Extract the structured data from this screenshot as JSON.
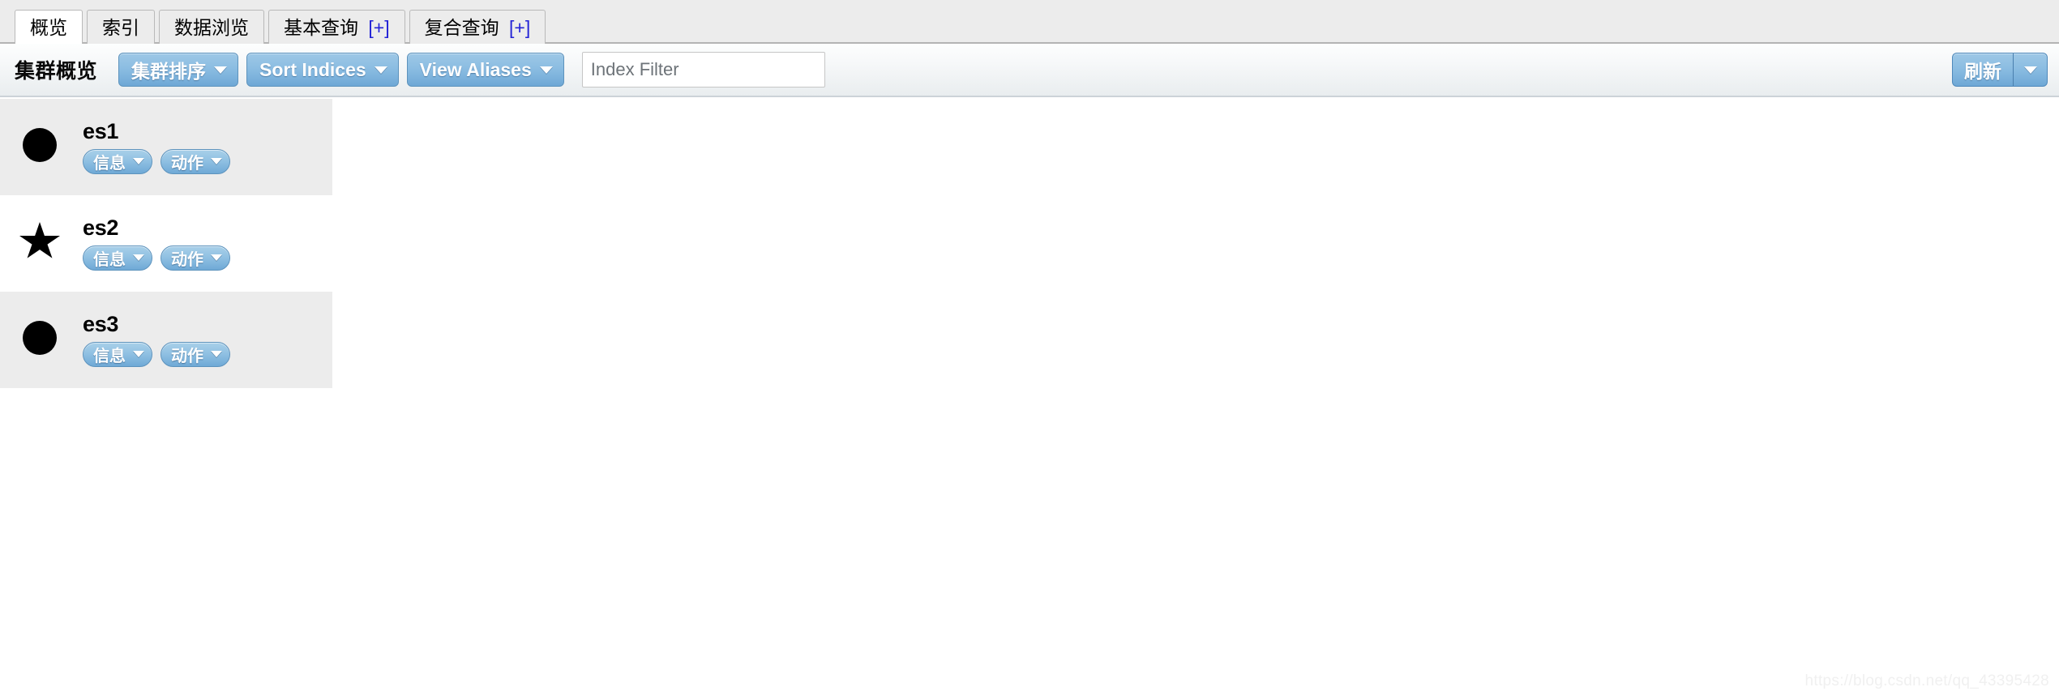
{
  "app": {
    "watermark": "https://blog.csdn.net/qq_43395428"
  },
  "tabs": [
    {
      "label": "概览",
      "plus": "",
      "active": true
    },
    {
      "label": "索引",
      "plus": "",
      "active": false
    },
    {
      "label": "数据浏览",
      "plus": "",
      "active": false
    },
    {
      "label": "基本查询",
      "plus": "[+]",
      "active": false
    },
    {
      "label": "复合查询",
      "plus": "[+]",
      "active": false
    }
  ],
  "toolbar": {
    "title": "集群概览",
    "sort_cluster_label": "集群排序",
    "sort_indices_label": "Sort Indices",
    "view_aliases_label": "View Aliases",
    "index_filter_placeholder": "Index Filter",
    "index_filter_value": "",
    "refresh_label": "刷新"
  },
  "cluster": {
    "node_button_info_label": "信息",
    "node_button_actions_label": "动作",
    "nodes": [
      {
        "name": "es1",
        "marker": "circle-icon",
        "shaded": true
      },
      {
        "name": "es2",
        "marker": "star-icon",
        "shaded": false
      },
      {
        "name": "es3",
        "marker": "circle-icon",
        "shaded": true
      }
    ]
  },
  "colors": {
    "accent_blue": "#6ea8d6",
    "accent_blue_light": "#9ec8e6",
    "tab_link_blue": "#2323d6",
    "row_shade": "#ececec",
    "toolbar_border": "#ccd2d8"
  }
}
